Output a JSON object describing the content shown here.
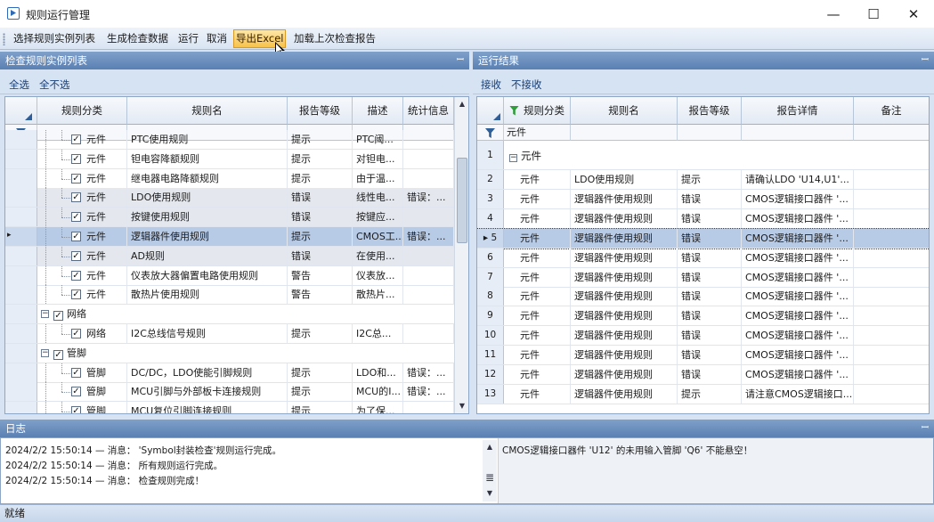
{
  "window": {
    "title": "规则运行管理",
    "minimize_glyph": "—",
    "maximize_glyph": "☐",
    "close_glyph": "✕"
  },
  "toolbar": {
    "items": [
      "选择规则实例列表",
      "生成检查数据",
      "运行",
      "取消",
      "导出Excel",
      "加载上次检查报告"
    ]
  },
  "left_panel": {
    "title": "检查规则实例列表",
    "pin_glyph": "ꟷ",
    "select_all": "全选",
    "select_none": "全不选",
    "columns": [
      "规则分类",
      "规则名",
      "报告等级",
      "描述",
      "统计信息"
    ],
    "rows": [
      {
        "category": "元件",
        "name": "PTC使用规则",
        "level": "提示",
        "desc": "PTC阈...",
        "stat": ""
      },
      {
        "category": "元件",
        "name": "钽电容降额规则",
        "level": "提示",
        "desc": "对钽电...",
        "stat": ""
      },
      {
        "category": "元件",
        "name": "继电器电路降额规则",
        "level": "提示",
        "desc": "由于温...",
        "stat": ""
      },
      {
        "category": "元件",
        "name": "LDO使用规则",
        "level": "错误",
        "desc": "线性电...",
        "stat": "错误：..."
      },
      {
        "category": "元件",
        "name": "按键使用规则",
        "level": "错误",
        "desc": "按键应...",
        "stat": ""
      },
      {
        "category": "元件",
        "name": "逻辑器件使用规则",
        "level": "提示",
        "desc": "CMOS工...",
        "stat": "错误：..."
      },
      {
        "category": "元件",
        "name": "AD规则",
        "level": "错误",
        "desc": "在使用...",
        "stat": ""
      },
      {
        "category": "元件",
        "name": "仪表放大器偏置电路使用规则",
        "level": "警告",
        "desc": "仪表放...",
        "stat": ""
      },
      {
        "category": "元件",
        "name": "散热片使用规则",
        "level": "警告",
        "desc": "散热片...",
        "stat": ""
      },
      {
        "group": "网络"
      },
      {
        "category": "网络",
        "name": "I2C总线信号规则",
        "level": "提示",
        "desc": "I2C总...",
        "stat": ""
      },
      {
        "group": "管脚"
      },
      {
        "category": "管脚",
        "name": "DC/DC，LDO使能引脚规则",
        "level": "提示",
        "desc": "LDO和...",
        "stat": "错误：..."
      },
      {
        "category": "管脚",
        "name": "MCU引脚与外部板卡连接规则",
        "level": "提示",
        "desc": "MCU的I...",
        "stat": "错误：..."
      },
      {
        "category": "管脚",
        "name": "MCU复位引脚连接规则",
        "level": "提示",
        "desc": "为了保...",
        "stat": ""
      }
    ]
  },
  "right_panel": {
    "title": "运行结果",
    "pin_glyph": "ꟷ",
    "accept": "接收",
    "reject": "不接收",
    "columns": [
      "规则分类",
      "规则名",
      "报告等级",
      "报告详情",
      "备注"
    ],
    "filter_value": "元件",
    "group_label": "元件",
    "rows": [
      {
        "no": "2",
        "category": "元件",
        "name": "LDO使用规则",
        "level": "提示",
        "detail": "请确认LDO 'U14,U1'..."
      },
      {
        "no": "3",
        "category": "元件",
        "name": "逻辑器件使用规则",
        "level": "错误",
        "detail": "CMOS逻辑接口器件 '..."
      },
      {
        "no": "4",
        "category": "元件",
        "name": "逻辑器件使用规则",
        "level": "错误",
        "detail": "CMOS逻辑接口器件 '..."
      },
      {
        "no": "5",
        "category": "元件",
        "name": "逻辑器件使用规则",
        "level": "错误",
        "detail": "CMOS逻辑接口器件 '..."
      },
      {
        "no": "6",
        "category": "元件",
        "name": "逻辑器件使用规则",
        "level": "错误",
        "detail": "CMOS逻辑接口器件 '..."
      },
      {
        "no": "7",
        "category": "元件",
        "name": "逻辑器件使用规则",
        "level": "错误",
        "detail": "CMOS逻辑接口器件 '..."
      },
      {
        "no": "8",
        "category": "元件",
        "name": "逻辑器件使用规则",
        "level": "错误",
        "detail": "CMOS逻辑接口器件 '..."
      },
      {
        "no": "9",
        "category": "元件",
        "name": "逻辑器件使用规则",
        "level": "错误",
        "detail": "CMOS逻辑接口器件 '..."
      },
      {
        "no": "10",
        "category": "元件",
        "name": "逻辑器件使用规则",
        "level": "错误",
        "detail": "CMOS逻辑接口器件 '..."
      },
      {
        "no": "11",
        "category": "元件",
        "name": "逻辑器件使用规则",
        "level": "错误",
        "detail": "CMOS逻辑接口器件 '..."
      },
      {
        "no": "12",
        "category": "元件",
        "name": "逻辑器件使用规则",
        "level": "错误",
        "detail": "CMOS逻辑接口器件 '..."
      },
      {
        "no": "13",
        "category": "元件",
        "name": "逻辑器件使用规则",
        "level": "提示",
        "detail": "请注意CMOS逻辑接口..."
      }
    ]
  },
  "log": {
    "title": "日志",
    "pin_glyph": "ꟷ",
    "lines": [
      "2024/2/2 15:50:14 — 消息： 'Symbol封装检查'规则运行完成。",
      "2024/2/2 15:50:14 — 消息： 所有规则运行完成。",
      "2024/2/2 15:50:14 — 消息： 检查规则完成！"
    ],
    "detail": "CMOS逻辑接口器件 'U12' 的未用输入管脚 'Q6' 不能悬空！"
  },
  "status": "就绪"
}
